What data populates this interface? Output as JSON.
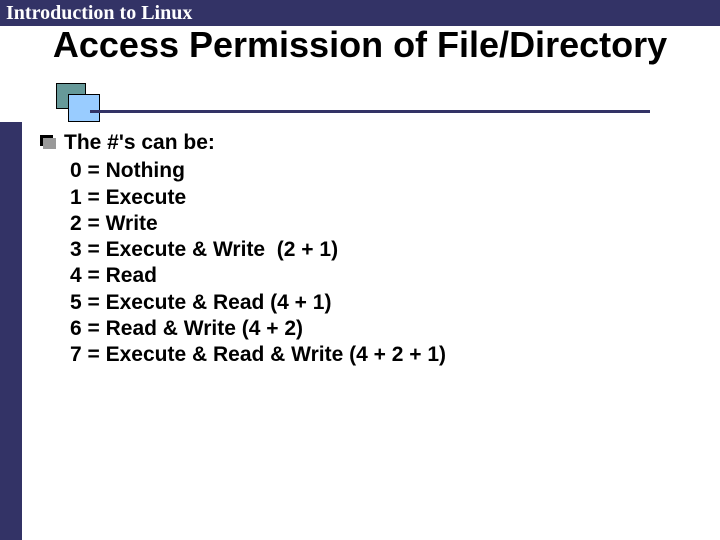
{
  "header": {
    "text": "Introduction to Linux"
  },
  "title": "Access Permission of File/Directory",
  "body": {
    "lead": "The #'s can be:",
    "permissions": [
      "0 = Nothing",
      "1 = Execute",
      "2 = Write",
      "3 = Execute & Write  (2 + 1)",
      "4 = Read",
      "5 = Execute & Read (4 + 1)",
      "6 = Read & Write (4 + 2)",
      "7 = Execute & Read & Write (4 + 2 + 1)"
    ]
  }
}
